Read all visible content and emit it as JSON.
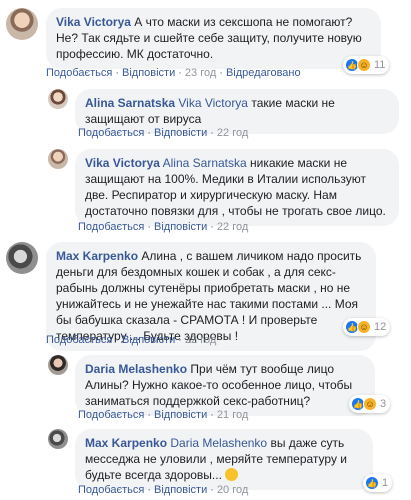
{
  "actions": {
    "like": "Подобається",
    "reply": "Відповісти",
    "edited": "Відредаговано",
    "sep": "·"
  },
  "comments": [
    {
      "author": "Vika Victorya",
      "text": "А что маски из сексшопа не помогают? Не? Так сядьте и сшейте себе защиту, получите новую профессию. МК достаточно.",
      "time": "23 год",
      "reaction_count": "11",
      "reactions": [
        "like-icon",
        "haha-icon"
      ]
    },
    {
      "author": "Alina Sarnatska",
      "mention": "Vika Victorya",
      "text": "такие маски не защищают от вируса",
      "time": "22 год"
    },
    {
      "author": "Vika Victorya",
      "mention": "Alina Sarnatska",
      "text": "никакие маски не защищают на 100%. Медики в Италии используют две. Респиратор и хирургическую маску. Нам достаточно повязки для , чтобы не трогать свое лицо.",
      "time": "22 год"
    },
    {
      "author": "Max Karpenko",
      "text": "Алина , с вашем личиком надо просить деньги для бездомных кошек и собак , а для секс-рабынь должны сутенёры приобретать маски , но не унижайтесь и не унежайте нас такими постами ... Моя бы бабушка сказала - СРАМОТА ! И проверьте температуру ... Будьте здоровы !",
      "time": "22 год",
      "reaction_count": "12",
      "reactions": [
        "like-icon",
        "haha-icon"
      ]
    },
    {
      "author": "Daria Melashenko",
      "text": "При чём тут вообще лицо Алины? Нужно какое-то особенное лицо, чтобы заниматься поддержкой секс-работниц?",
      "time": "21 год",
      "reaction_count": "3",
      "reactions": [
        "like-icon",
        "haha-icon"
      ]
    },
    {
      "author": "Max Karpenko",
      "mention": "Daria Melashenko",
      "text": "вы даже суть месседжа не уловили , меряйте температуру и будьте всегда здоровы...",
      "time": "20 год",
      "reaction_count": "1",
      "reactions": [
        "like-icon"
      ]
    }
  ]
}
